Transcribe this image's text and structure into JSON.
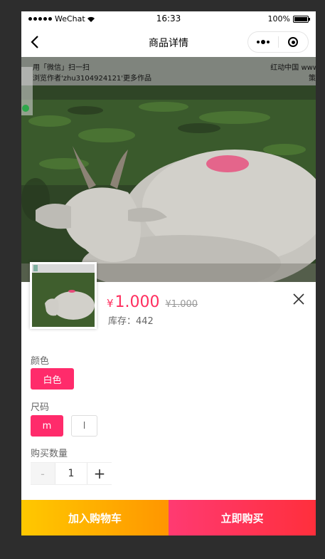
{
  "status_bar": {
    "carrier": "WeChat",
    "time": "16:33",
    "battery": "100%",
    "battery_level": 1.0
  },
  "nav": {
    "title": "商品详情",
    "back_icon": "chevron-left-icon",
    "more_icon": "more-dots-icon",
    "close_icon": "target-circle-icon"
  },
  "product_image": {
    "watermark_line1": "用「微信」扫一扫",
    "watermark_line2": "浏览作者'zhu3104924121'更多作品",
    "watermark_right1": "红动中国 www",
    "watermark_right2": "策"
  },
  "sku": {
    "currency": "¥",
    "price": "1.000",
    "original_price": "¥1.000",
    "stock": "库存：442",
    "color_label": "颜色",
    "colors": [
      "白色"
    ],
    "size_label": "尺码",
    "sizes": [
      "m",
      "l"
    ],
    "quantity_label": "购买数量",
    "quantity": "1",
    "minus": "-",
    "plus": "+"
  },
  "actions": {
    "add_to_cart": "加入购物车",
    "buy_now": "立即购买"
  },
  "colors": {
    "accent": "#ff2b6b",
    "cart_gradient": [
      "#ffc800",
      "#ff9600"
    ],
    "buy_gradient": [
      "#ff3a72",
      "#ff2f3c"
    ]
  }
}
